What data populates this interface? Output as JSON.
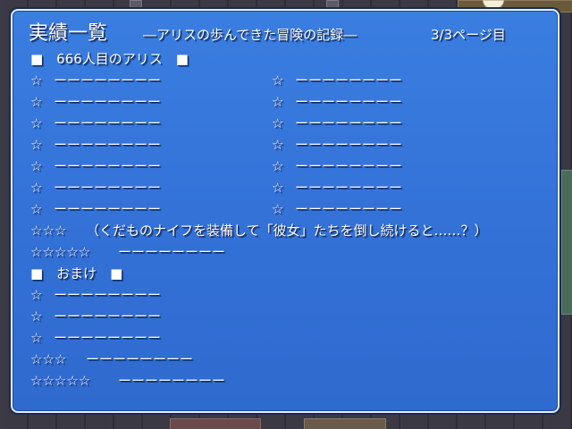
{
  "header": {
    "title": "実績一覧",
    "subtitle": "―アリスの歩んできた冒険の記録―",
    "page_indicator": "3/3ページ目"
  },
  "section_main": {
    "heading": "■　666人目のアリス　■",
    "left_items": [
      {
        "mark": "☆",
        "text": "ーーーーーーーー"
      },
      {
        "mark": "☆",
        "text": "ーーーーーーーー"
      },
      {
        "mark": "☆",
        "text": "ーーーーーーーー"
      },
      {
        "mark": "☆",
        "text": "ーーーーーーーー"
      },
      {
        "mark": "☆",
        "text": "ーーーーーーーー"
      },
      {
        "mark": "☆",
        "text": "ーーーーーーーー"
      },
      {
        "mark": "☆",
        "text": "ーーーーーーーー"
      }
    ],
    "right_items": [
      {
        "mark": "☆",
        "text": "ーーーーーーーー"
      },
      {
        "mark": "☆",
        "text": "ーーーーーーーー"
      },
      {
        "mark": "☆",
        "text": "ーーーーーーーー"
      },
      {
        "mark": "☆",
        "text": "ーーーーーーーー"
      },
      {
        "mark": "☆",
        "text": "ーーーーーーーー"
      },
      {
        "mark": "☆",
        "text": "ーーーーーーーー"
      },
      {
        "mark": "☆",
        "text": "ーーーーーーーー"
      }
    ],
    "three_star": {
      "mark": "☆☆☆",
      "text": "（くだものナイフを装備して「彼女」たちを倒し続けると……？）"
    },
    "five_star": {
      "mark": "☆☆☆☆☆",
      "text": "ーーーーーーーー"
    }
  },
  "section_bonus": {
    "heading": "■　おまけ　■",
    "items": [
      {
        "mark": "☆",
        "text": "ーーーーーーーー"
      },
      {
        "mark": "☆",
        "text": "ーーーーーーーー"
      },
      {
        "mark": "☆",
        "text": "ーーーーーーーー"
      }
    ],
    "three_star": {
      "mark": "☆☆☆",
      "text": "ーーーーーーーー"
    },
    "five_star": {
      "mark": "☆☆☆☆☆",
      "text": "ーーーーーーーー"
    }
  },
  "colors": {
    "window_bg": "#3472d8",
    "window_border": "#e8eef8",
    "text": "#ffffff"
  }
}
